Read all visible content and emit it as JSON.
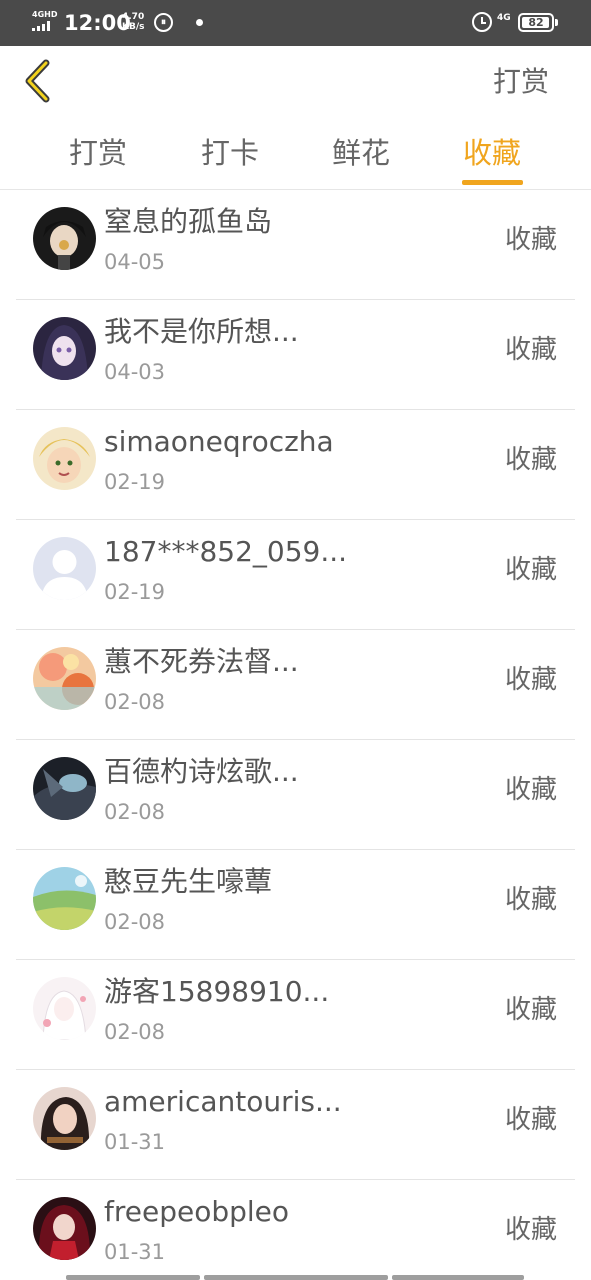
{
  "status_bar": {
    "network": "4GHD",
    "time": "12:00",
    "speed_value": "4.70",
    "speed_unit": "KB/s",
    "network_right": "4G",
    "battery": "82"
  },
  "header": {
    "back_icon": "chevron-left-icon",
    "title": "打赏"
  },
  "tabs": [
    {
      "label": "打赏",
      "active": false
    },
    {
      "label": "打卡",
      "active": false
    },
    {
      "label": "鲜花",
      "active": false
    },
    {
      "label": "收藏",
      "active": true
    }
  ],
  "accent_color": "#f0a51e",
  "items": [
    {
      "name": "窒息的孤鱼岛",
      "date": "04-05",
      "action": "收藏"
    },
    {
      "name": "我不是你所想...",
      "date": "04-03",
      "action": "收藏"
    },
    {
      "name": "simaoneqroczha",
      "date": "02-19",
      "action": "收藏"
    },
    {
      "name": "187***852_059...",
      "date": "02-19",
      "action": "收藏"
    },
    {
      "name": "蕙不死券法督...",
      "date": "02-08",
      "action": "收藏"
    },
    {
      "name": "百德杓诗炫歌...",
      "date": "02-08",
      "action": "收藏"
    },
    {
      "name": "憨豆先生嚎蕈",
      "date": "02-08",
      "action": "收藏"
    },
    {
      "name": "游客15898910...",
      "date": "02-08",
      "action": "收藏"
    },
    {
      "name": "americantouris...",
      "date": "01-31",
      "action": "收藏"
    },
    {
      "name": "freepeobpleo",
      "date": "01-31",
      "action": "收藏"
    }
  ]
}
